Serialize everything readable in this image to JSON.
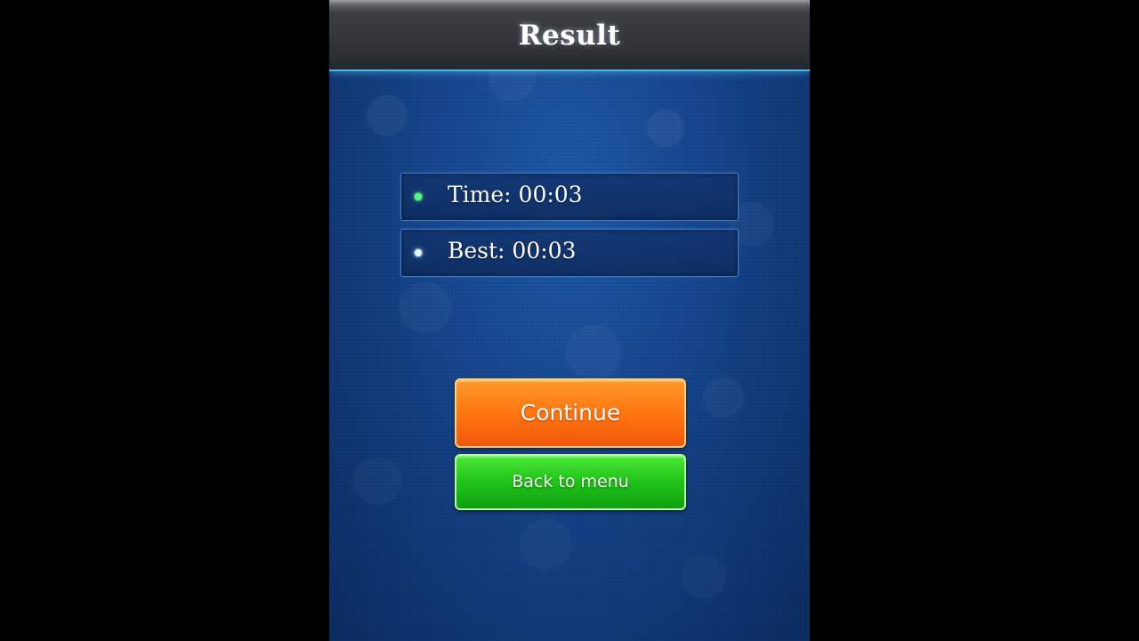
{
  "header": {
    "title": "Result"
  },
  "stats": {
    "time": "Time: 00:03",
    "best": "Best: 00:03"
  },
  "buttons": {
    "continue_label": "Continue",
    "back_label": "Back to menu"
  },
  "colors": {
    "header_accent": "#4fb3e6",
    "continue_button": "#ff7a12",
    "back_button": "#22c61a",
    "bullet_time": "#4dff7a",
    "bullet_best": "#e6f6ff"
  },
  "icons": {
    "time_bullet": "bullet-icon",
    "best_bullet": "bullet-icon"
  }
}
